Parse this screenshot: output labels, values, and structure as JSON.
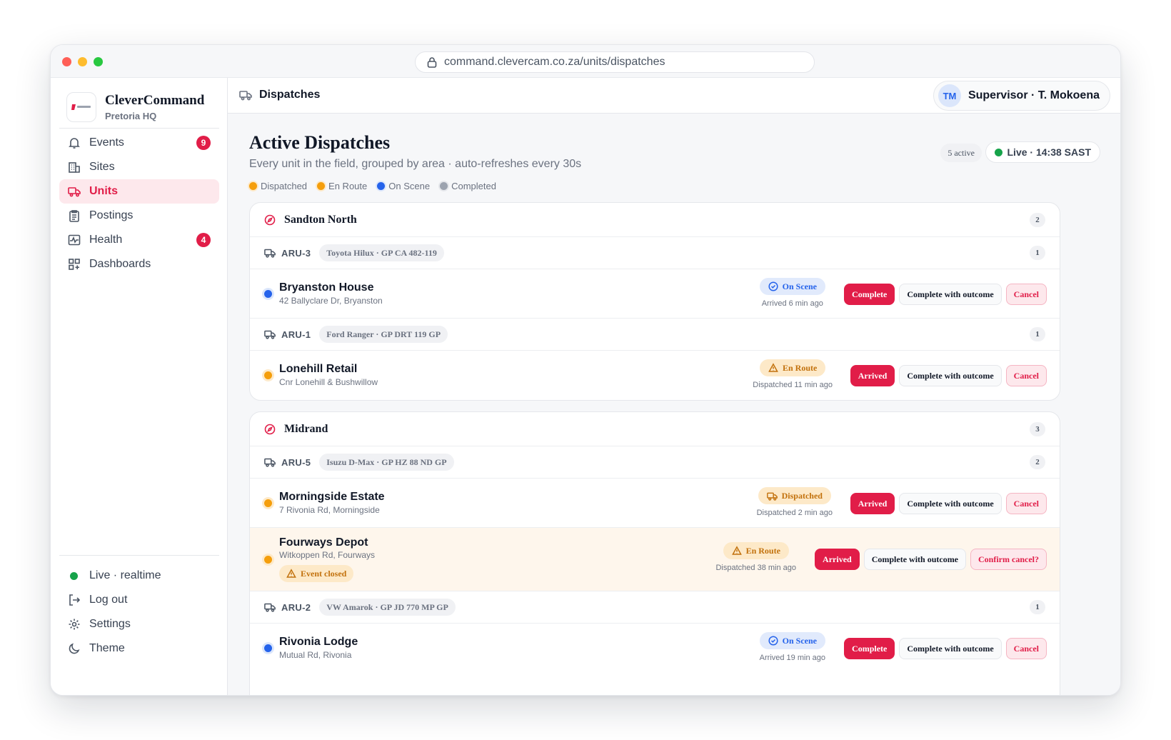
{
  "browser": {
    "url": "command.clevercam.co.za/units/dispatches"
  },
  "brand": {
    "name": "CleverCommand",
    "subtitle": "Pretoria HQ"
  },
  "sidebar": {
    "items": [
      {
        "label": "Events",
        "icon": "bell-icon",
        "badge": "9"
      },
      {
        "label": "Sites",
        "icon": "building-icon"
      },
      {
        "label": "Units",
        "icon": "truck-icon",
        "active": true
      },
      {
        "label": "Postings",
        "icon": "clipboard-icon"
      },
      {
        "label": "Health",
        "icon": "activity-icon",
        "badge": "4"
      },
      {
        "label": "Dashboards",
        "icon": "grid-icon"
      }
    ],
    "bottom": [
      {
        "label": "Live · realtime",
        "icon": "status-dot"
      },
      {
        "label": "Log out",
        "icon": "logout-icon"
      },
      {
        "label": "Settings",
        "icon": "gear-icon"
      },
      {
        "label": "Theme",
        "icon": "moon-icon"
      }
    ]
  },
  "topbar": {
    "crumb": "Dispatches",
    "user_initials": "TM",
    "user_label": "Supervisor · T. Mokoena"
  },
  "page": {
    "title": "Active Dispatches",
    "subtitle": "Every unit in the field, grouped by area · auto-refreshes every 30s",
    "active_count": "5 active",
    "live_label": "Live · 14:38 SAST",
    "legend": [
      {
        "label": "Dispatched",
        "color": "#f59e0b"
      },
      {
        "label": "En Route",
        "color": "#f59e0b"
      },
      {
        "label": "On Scene",
        "color": "#2563eb"
      },
      {
        "label": "Completed",
        "color": "#9ca3af"
      }
    ]
  },
  "colors": {
    "accent": "#e11d48",
    "on_scene": "#2563eb",
    "en_route": "#f59e0b",
    "live": "#16a34a"
  },
  "areas": [
    {
      "name": "Sandton North",
      "count": "2",
      "units": [
        {
          "code": "ARU-3",
          "vehicle": "Toyota Hilux · GP CA 482-119",
          "count": "1",
          "dispatches": [
            {
              "site": "Bryanston House",
              "address": "42 Ballyclare Dr, Bryanston",
              "status": "On Scene",
              "time": "Arrived 6 min ago",
              "primary": "Complete",
              "outcome": "Complete with outcome",
              "cancel": "Cancel"
            }
          ]
        },
        {
          "code": "ARU-1",
          "vehicle": "Ford Ranger · GP DRT 119 GP",
          "count": "1",
          "dispatches": [
            {
              "site": "Lonehill Retail",
              "address": "Cnr Lonehill & Bushwillow",
              "status": "En Route",
              "time": "Dispatched 11 min ago",
              "primary": "Arrived",
              "outcome": "Complete with outcome",
              "cancel": "Cancel"
            }
          ]
        }
      ]
    },
    {
      "name": "Midrand",
      "count": "3",
      "units": [
        {
          "code": "ARU-5",
          "vehicle": "Isuzu D-Max · GP HZ 88 ND GP",
          "count": "2",
          "dispatches": [
            {
              "site": "Morningside Estate",
              "address": "7 Rivonia Rd, Morningside",
              "status": "Dispatched",
              "time": "Dispatched 2 min ago",
              "primary": "Arrived",
              "outcome": "Complete with outcome",
              "cancel": "Cancel"
            },
            {
              "site": "Fourways Depot",
              "address": "Witkoppen Rd, Fourways",
              "flag": "Event closed",
              "status": "En Route",
              "time": "Dispatched 38 min ago",
              "primary": "Arrived",
              "outcome": "Complete with outcome",
              "cancel": "Confirm cancel?"
            }
          ]
        },
        {
          "code": "ARU-2",
          "vehicle": "VW Amarok · GP JD 770 MP GP",
          "count": "1",
          "dispatches": [
            {
              "site": "Rivonia Lodge",
              "address": "Mutual Rd, Rivonia",
              "status": "On Scene",
              "time": "Arrived 19 min ago",
              "primary": "Complete",
              "outcome": "Complete with outcome",
              "cancel": "Cancel"
            }
          ]
        }
      ]
    }
  ]
}
